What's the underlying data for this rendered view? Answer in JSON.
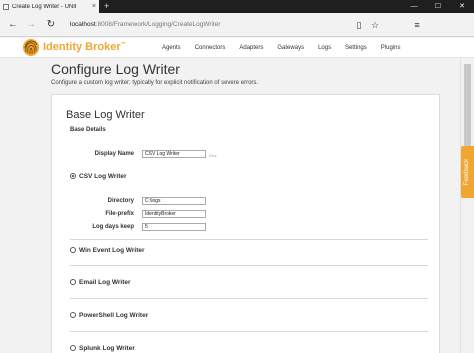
{
  "browser": {
    "tab_title": "Create Log Writer - UNII",
    "tab_close": "×",
    "new_tab": "+",
    "window_buttons": [
      "—",
      "☐",
      "✕"
    ],
    "url_host": "localhost",
    "url_path": ":8008/Framework/Logging/CreateLogWriter",
    "back": "←",
    "forward": "→",
    "refresh": "↻",
    "reading_view": "▯",
    "favorite": "☆",
    "menu": "≡"
  },
  "header": {
    "brand": "Identity Broker",
    "brand_tm": "™",
    "nav": [
      "Agents",
      "Connectors",
      "Adapters",
      "Gateways",
      "Logs",
      "Settings",
      "Plugins"
    ]
  },
  "page": {
    "title": "Configure Log Writer",
    "subtitle": "Configure a custom log writer; typically for explicit notification of severe errors."
  },
  "card": {
    "title": "Base Log Writer",
    "section": "Base Details",
    "display_name_label": "Display Name",
    "display_name_value": "CSV Log Writer",
    "display_name_hint": "Req."
  },
  "writers": [
    {
      "label": "CSV Log Writer",
      "checked": true
    },
    {
      "label": "Win Event Log Writer",
      "checked": false
    },
    {
      "label": "Email Log Writer",
      "checked": false
    },
    {
      "label": "PowerShell Log Writer",
      "checked": false
    },
    {
      "label": "Splunk Log Writer",
      "checked": false
    }
  ],
  "csv": {
    "directory_label": "Directory",
    "directory_value": "C:\\logs",
    "prefix_label": "File-prefix",
    "prefix_value": "IdentityBroker",
    "days_label": "Log days keep",
    "days_value": "5"
  },
  "feedback": "Feedback",
  "colors": {
    "brand": "#f0a630",
    "tabstrip": "#1f1f1f",
    "background": "#f2f2f2"
  }
}
